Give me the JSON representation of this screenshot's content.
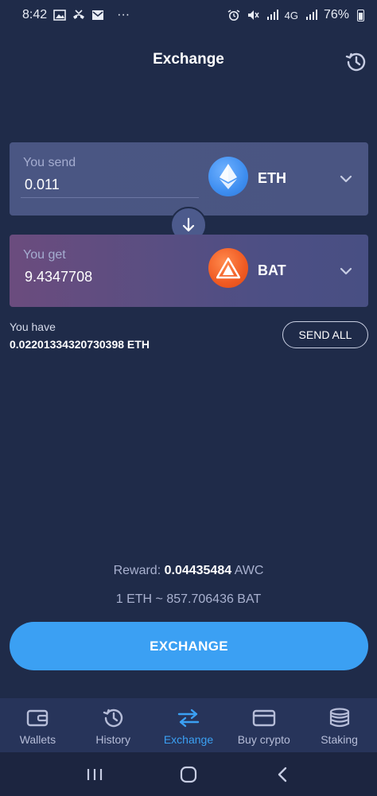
{
  "status_bar": {
    "time": "8:42",
    "more": "···",
    "network": "4G",
    "battery": "76%"
  },
  "header": {
    "title": "Exchange",
    "history_icon": "history-icon"
  },
  "send_card": {
    "label": "You send",
    "value": "0.011",
    "coin": "ETH",
    "coin_icon": "ethereum-icon"
  },
  "get_card": {
    "label": "You get",
    "value": "9.4347708",
    "coin": "BAT",
    "coin_icon": "bat-icon"
  },
  "balance": {
    "label": "You have",
    "value": "0.02201334320730398 ETH",
    "send_all": "SEND ALL"
  },
  "reward": {
    "label": "Reward:",
    "amount": "0.04435484",
    "unit": "AWC"
  },
  "rate": "1 ETH ~ 857.706436 BAT",
  "exchange_button": "EXCHANGE",
  "tabs": [
    {
      "label": "Wallets",
      "icon": "wallet-icon",
      "active": false
    },
    {
      "label": "History",
      "icon": "history-icon",
      "active": false
    },
    {
      "label": "Exchange",
      "icon": "exchange-arrows-icon",
      "active": true
    },
    {
      "label": "Buy crypto",
      "icon": "credit-card-icon",
      "active": false
    },
    {
      "label": "Staking",
      "icon": "coins-stack-icon",
      "active": false
    }
  ],
  "colors": {
    "background": "#1f2b49",
    "accent": "#3ba0f3",
    "eth": "#3e8ef0",
    "bat": "#f05a22"
  }
}
